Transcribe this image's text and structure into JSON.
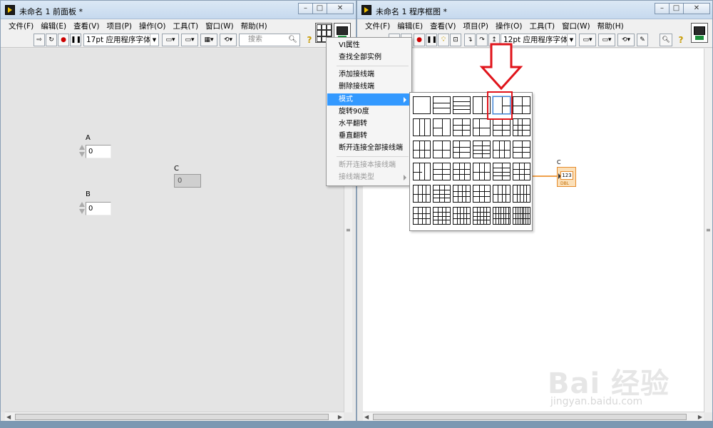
{
  "left_window": {
    "title": "未命名 1 前面板 *",
    "menus": [
      "文件(F)",
      "编辑(E)",
      "查看(V)",
      "项目(P)",
      "操作(O)",
      "工具(T)",
      "窗口(W)",
      "帮助(H)"
    ],
    "font_select": "17pt 应用程序字体",
    "search_placeholder": "搜索",
    "controls": {
      "A": {
        "label": "A",
        "value": "0"
      },
      "B": {
        "label": "B",
        "value": "0"
      },
      "C": {
        "label": "C",
        "value": "0"
      }
    }
  },
  "right_window": {
    "title": "未命名 1 程序框图 *",
    "menus": [
      "文件(F)",
      "编辑(E)",
      "查看(V)",
      "项目(P)",
      "操作(O)",
      "工具(T)",
      "窗口(W)",
      "帮助(H)"
    ],
    "font_select": "12pt 应用程序字体",
    "terminal": {
      "label": "C",
      "value": "123",
      "type": "DBL"
    }
  },
  "context_menu": {
    "items": [
      {
        "label": "VI属性",
        "enabled": true
      },
      {
        "label": "查找全部实例",
        "enabled": true
      },
      {
        "label": "添加接线端",
        "enabled": true
      },
      {
        "label": "删除接线端",
        "enabled": true
      },
      {
        "label": "模式",
        "enabled": true,
        "highlighted": true,
        "submenu": true
      },
      {
        "label": "旋转90度",
        "enabled": true
      },
      {
        "label": "水平翻转",
        "enabled": true
      },
      {
        "label": "垂直翻转",
        "enabled": true
      },
      {
        "label": "断开连接全部接线端",
        "enabled": true
      },
      {
        "label": "断开连接本接线端",
        "enabled": false
      },
      {
        "label": "接线端类型",
        "enabled": false,
        "submenu": true
      }
    ]
  },
  "watermark": {
    "brand": "Bai 经验",
    "url": "jingyan.baidu.com"
  },
  "colors": {
    "highlight": "#3399ff",
    "annotation_red": "#e0141b",
    "wire_orange": "#f0a04b"
  }
}
